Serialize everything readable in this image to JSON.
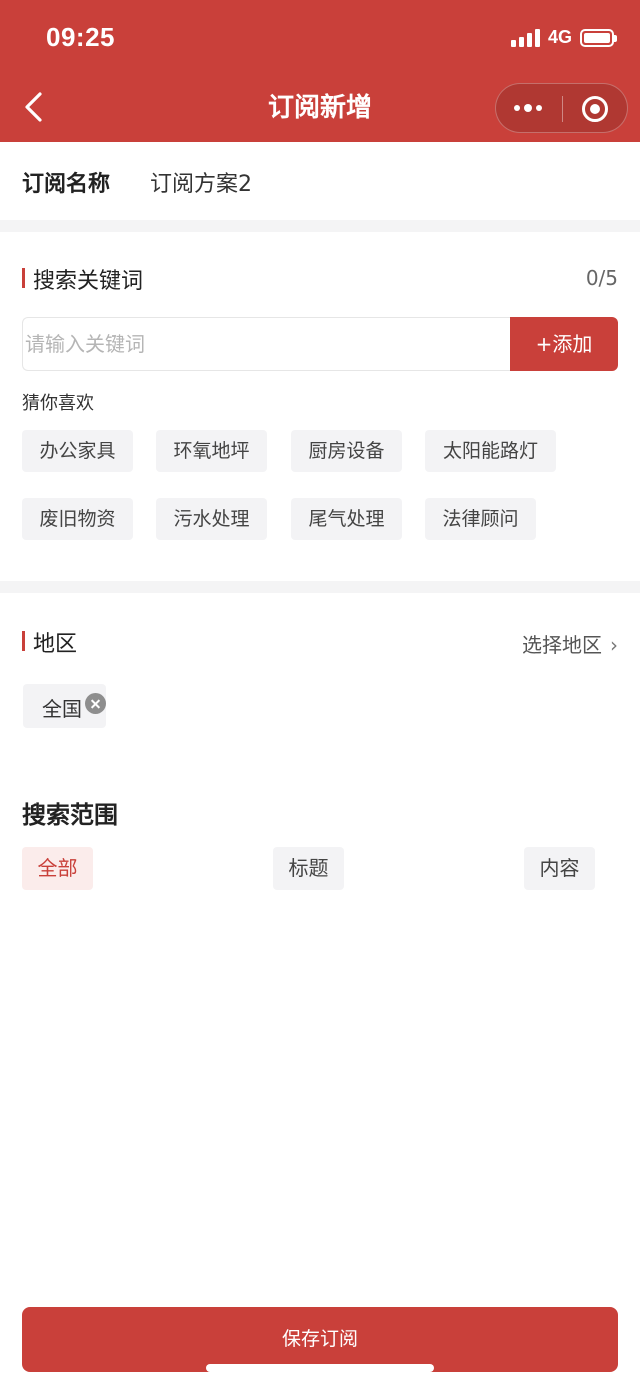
{
  "status_bar": {
    "time": "09:25",
    "network": "4G"
  },
  "nav": {
    "title": "订阅新增"
  },
  "subscription": {
    "label": "订阅名称",
    "value": "订阅方案2"
  },
  "keywords": {
    "title": "搜索关键词",
    "counter": "0/5",
    "placeholder": "请输入关键词",
    "add_label": "+添加",
    "guess_label": "猜你喜欢",
    "suggestions": [
      "办公家具",
      "环氧地坪",
      "厨房设备",
      "太阳能路灯",
      "废旧物资",
      "污水处理",
      "尾气处理",
      "法律顾问"
    ]
  },
  "region": {
    "title": "地区",
    "select_label": "选择地区",
    "selected": [
      "全国"
    ]
  },
  "scope": {
    "title": "搜索范围",
    "options": [
      "全部",
      "标题",
      "内容"
    ],
    "selected": "全部"
  },
  "save_label": "保存订阅",
  "colors": {
    "primary": "#c9403a",
    "chip_bg": "#f3f3f5",
    "active_bg": "#fbeceb"
  }
}
